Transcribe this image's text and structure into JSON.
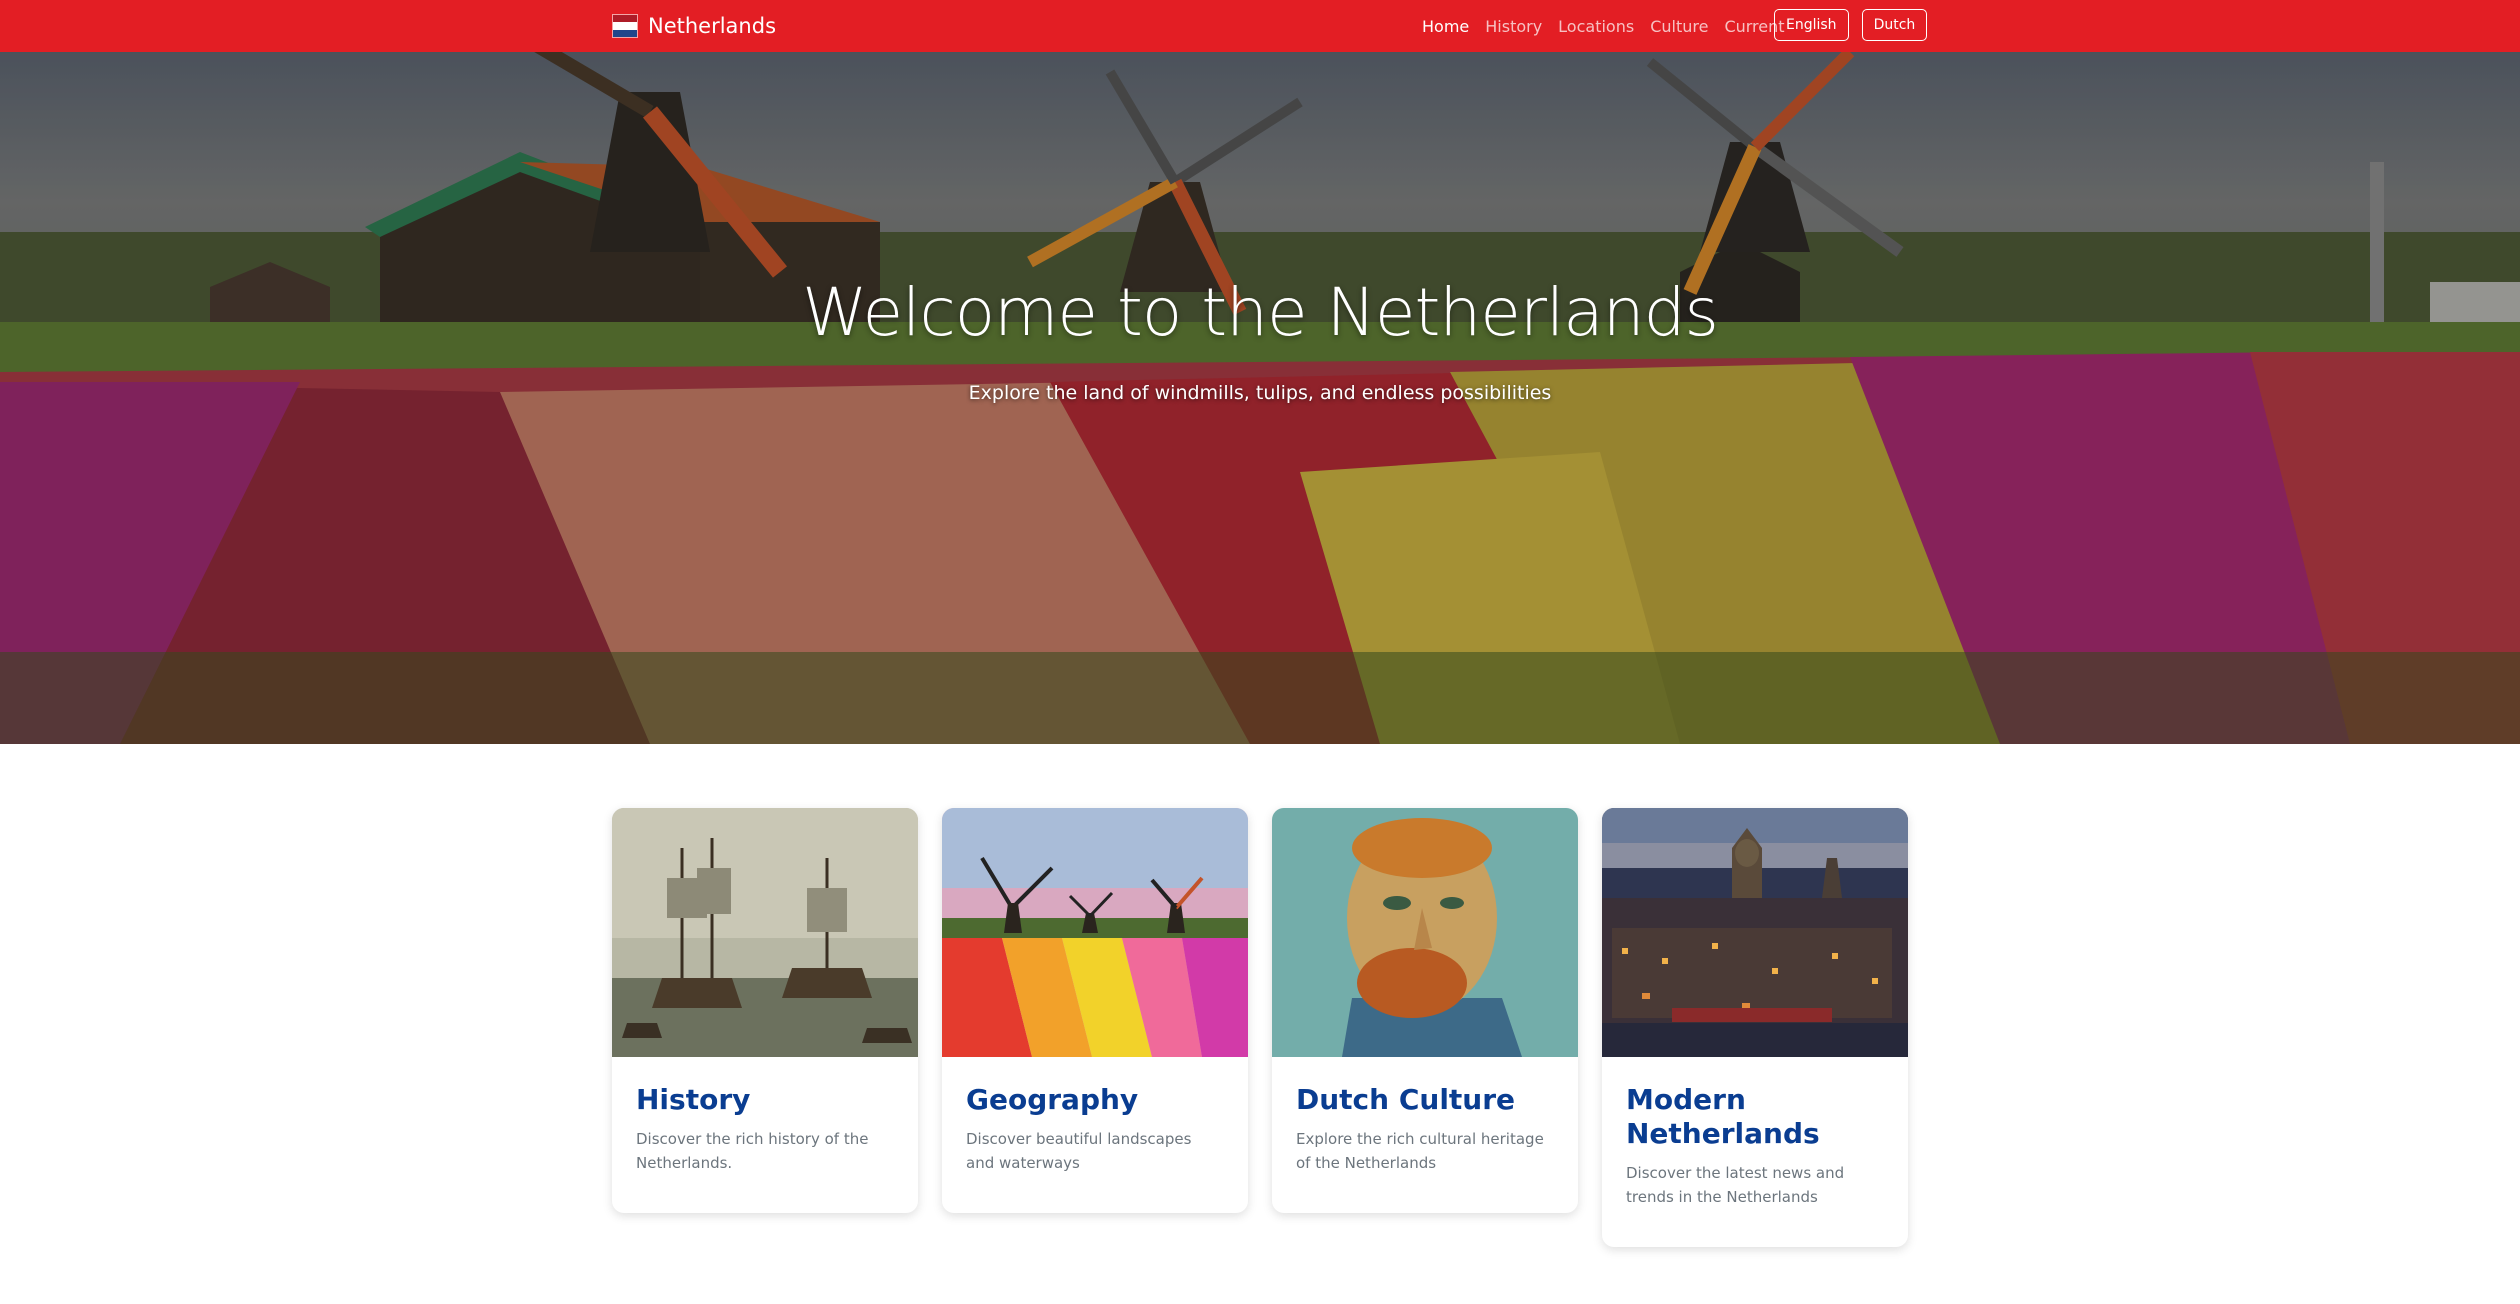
{
  "navbar": {
    "brand": "Netherlands",
    "links": [
      {
        "label": "Home",
        "active": true
      },
      {
        "label": "History",
        "active": false
      },
      {
        "label": "Locations",
        "active": false
      },
      {
        "label": "Culture",
        "active": false
      },
      {
        "label": "Current",
        "active": false
      }
    ],
    "languages": [
      "English",
      "Dutch"
    ],
    "background_color": "#e31e24"
  },
  "hero": {
    "title": "Welcome to the Netherlands",
    "subtitle": "Explore the land of windmills, tulips, and endless possibilities"
  },
  "cards": [
    {
      "title": "History",
      "text": "Discover the rich history of the Netherlands.",
      "image": "sailing-ships-painting"
    },
    {
      "title": "Geography",
      "text": "Discover beautiful landscapes and waterways",
      "image": "windmills-tulip-field"
    },
    {
      "title": "Dutch Culture",
      "text": "Explore the rich cultural heritage of the Netherlands",
      "image": "van-gogh-self-portrait"
    },
    {
      "title": "Modern Netherlands",
      "text": "Discover the latest news and trends in the Netherlands",
      "image": "amsterdam-night-cityscape"
    }
  ],
  "colors": {
    "accent": "#e31e24",
    "card_title": "#0a3d91",
    "card_text": "#6c757d"
  }
}
